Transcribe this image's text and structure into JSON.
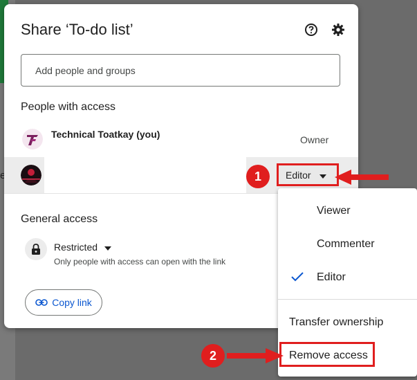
{
  "dialog": {
    "title": "Share ‘To-do list’",
    "help_icon": "help-circle-icon",
    "settings_icon": "gear-icon",
    "add_people_placeholder": "Add people and groups"
  },
  "people_section": {
    "heading": "People with access",
    "people": [
      {
        "name": "Technical Toatkay (you)",
        "role": "Owner"
      },
      {
        "name": "",
        "role": "Editor"
      }
    ]
  },
  "general_access": {
    "heading": "General access",
    "level": "Restricted",
    "description": "Only people with access can open with the link"
  },
  "copy_link_label": "Copy link",
  "role_menu": {
    "items": [
      "Viewer",
      "Commenter",
      "Editor"
    ],
    "selected": "Editor",
    "transfer": "Transfer ownership",
    "remove": "Remove access"
  },
  "annotations": {
    "step1": "1",
    "step2": "2",
    "highlight_color": "#e01e1e"
  },
  "colors": {
    "accent": "#0b57d0",
    "owner_logo": "#7b1f5e"
  }
}
